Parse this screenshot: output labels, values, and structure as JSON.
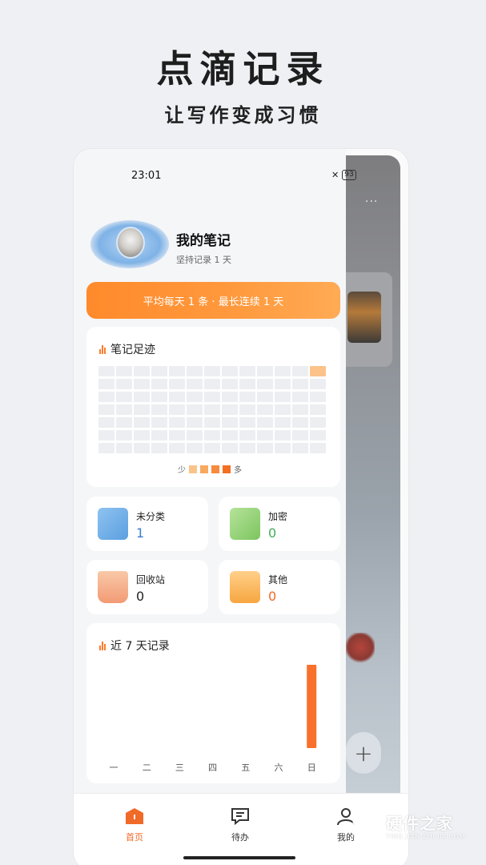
{
  "promo": {
    "title": "点滴记录",
    "subtitle": "让写作变成习惯"
  },
  "status_bar": {
    "time": "23:01",
    "battery": "93"
  },
  "profile": {
    "name": "我的笔记",
    "subtitle": "坚持记录 1 天"
  },
  "streak_banner": "平均每天 1 条 · 最长连续 1 天",
  "heatmap": {
    "title": "笔记足迹",
    "legend_low": "少",
    "legend_high": "多",
    "legend_colors": [
      "#fbc38a",
      "#f9a860",
      "#f78a3c",
      "#f46f22"
    ],
    "rows": 7,
    "cols": 13,
    "active_cells": [
      {
        "row": 0,
        "col": 12,
        "level": 1
      }
    ]
  },
  "categories": [
    {
      "label": "未分类",
      "count": "1",
      "count_color": "#3a7bd5",
      "icon": "blue-notebook-icon"
    },
    {
      "label": "加密",
      "count": "0",
      "count_color": "#3fae5a",
      "icon": "green-lock-notebook-icon"
    },
    {
      "label": "回收站",
      "count": "0",
      "count_color": "#222222",
      "icon": "recycle-bin-icon"
    },
    {
      "label": "其他",
      "count": "0",
      "count_color": "#f06a28",
      "icon": "orange-folder-icon"
    }
  ],
  "chart_data": {
    "type": "bar",
    "title": "近 7 天记录",
    "categories": [
      "一",
      "二",
      "三",
      "四",
      "五",
      "六",
      "日"
    ],
    "values": [
      0,
      0,
      0,
      0,
      0,
      0,
      1
    ],
    "ylim": [
      0,
      1
    ],
    "bar_color": "#f8702c",
    "grid": false
  },
  "tabbar": {
    "items": [
      {
        "label": "首页",
        "active": true,
        "icon": "home-icon"
      },
      {
        "label": "待办",
        "active": false,
        "icon": "chat-todo-icon"
      },
      {
        "label": "我的",
        "active": false,
        "icon": "user-icon"
      }
    ],
    "active_color": "#f06a28"
  },
  "background_app": {
    "more": "···",
    "fab": "+"
  },
  "watermark": {
    "name": "硬件之家",
    "url": "YING JIAN ZHI JIA.COM"
  }
}
